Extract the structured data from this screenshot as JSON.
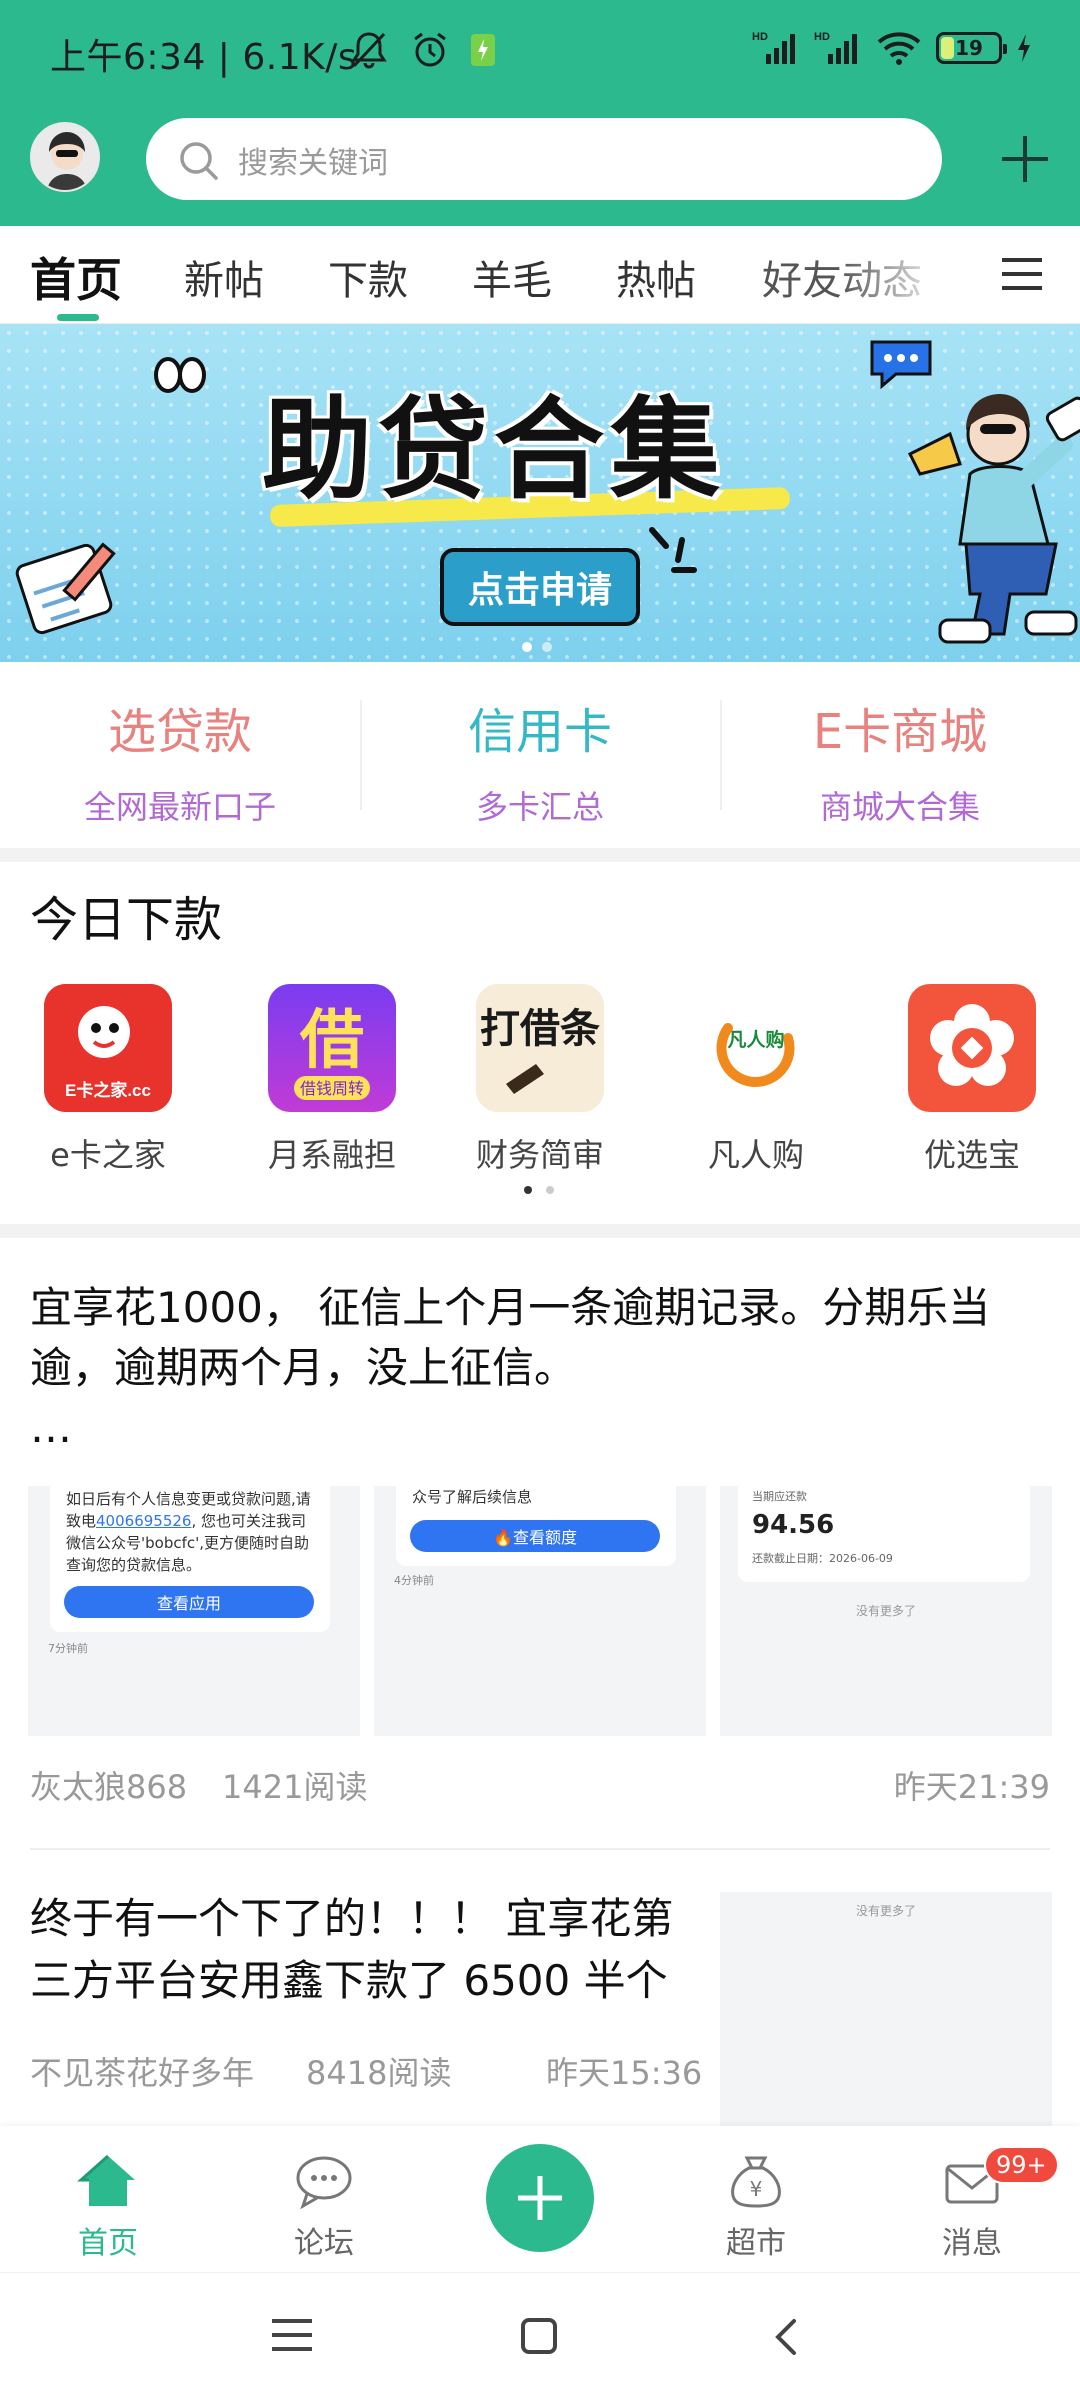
{
  "status_bar": {
    "time": "上午6:34",
    "speed": "6.1K/s",
    "net1": "HD",
    "net2": "HD",
    "battery": "19"
  },
  "header": {
    "search_placeholder": "搜索关键词",
    "accent_color": "#2cb98e"
  },
  "tabs": [
    {
      "label": "首页",
      "active": true
    },
    {
      "label": "新帖"
    },
    {
      "label": "下款"
    },
    {
      "label": "羊毛"
    },
    {
      "label": "热帖"
    },
    {
      "label": "好友动态"
    }
  ],
  "banner": {
    "title": "助贷合集",
    "button": "点击申请",
    "slide_count": 2,
    "current_slide": 1
  },
  "quick": [
    {
      "title": "选贷款",
      "sub": "全网最新口子",
      "color": "#e8827f"
    },
    {
      "title": "信用卡",
      "sub": "多卡汇总",
      "color": "#34b8c6"
    },
    {
      "title": "E卡商城",
      "sub": "商城大合集",
      "color": "#e8827f"
    }
  ],
  "today": {
    "title": "今日下款",
    "apps": [
      {
        "name": "e卡之家",
        "icon_text": "E卡之家.cc"
      },
      {
        "name": "月系融担",
        "icon_text": "借",
        "icon_sub": "借钱周转"
      },
      {
        "name": "财务简审",
        "icon_text": "打借条"
      },
      {
        "name": "凡人购",
        "icon_text": "凡人购"
      },
      {
        "name": "优选宝"
      }
    ]
  },
  "post1": {
    "text": "宜享花1000， 征信上个月一条逾期记录。分期乐当逾，逾期两个月，没上征信。",
    "more": "…",
    "thumb1": {
      "text": "如日后有个人信息变更或贷款问题,请致电",
      "phone": "4006695526",
      "text2": ", 您也可关注我司微信公众号'bobcfc',更方便随时自助查询您的贷款信息。",
      "button": "查看应用",
      "time": "7分钟前"
    },
    "thumb2": {
      "text": "众号了解后续信息",
      "button": "🔥查看额度",
      "time": "4分钟前"
    },
    "thumb3": {
      "label": "当期应还款",
      "amount": "94.56",
      "due": "还款截止日期：2026-06-09",
      "nomore": "没有更多了"
    },
    "author": "灰太狼868",
    "reads": "1421阅读",
    "time": "昨天21:39"
  },
  "post2": {
    "text": "终于有一个下了的！！！ 宜享花第三方平台安用鑫下款了 6500 半个",
    "thumb_text": "没有更多了",
    "author": "不见茶花好多年",
    "reads": "8418阅读",
    "time": "昨天15:36"
  },
  "bottom_nav": {
    "items": [
      {
        "label": "首页",
        "active": true
      },
      {
        "label": "论坛"
      },
      {
        "label": "超市"
      },
      {
        "label": "消息"
      }
    ],
    "badge": "99+"
  }
}
